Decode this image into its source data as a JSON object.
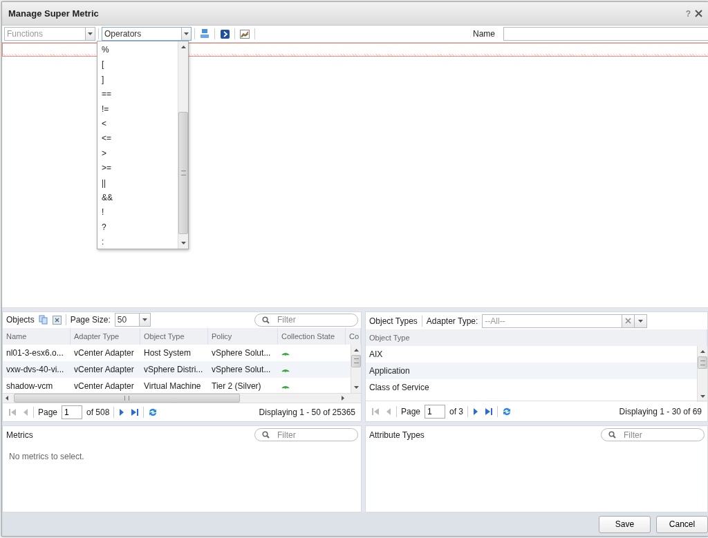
{
  "window": {
    "title": "Manage Super Metric",
    "help": "?"
  },
  "toolbar": {
    "functions": {
      "placeholder": "Functions"
    },
    "operators": {
      "value": "Operators",
      "expanded": true
    },
    "name_label": "Name"
  },
  "operators_menu": {
    "items": [
      "%",
      "[",
      "]",
      "==",
      "!=",
      "<",
      "<=",
      ">",
      ">=",
      "||",
      "&&",
      "!",
      "?",
      ":"
    ]
  },
  "editor": {
    "invalid": true
  },
  "objects": {
    "title": "Objects",
    "page_size_label": "Page Size:",
    "page_size": "50",
    "filter": {
      "placeholder": "Filter"
    },
    "columns": [
      "Name",
      "Adapter Type",
      "Object Type",
      "Policy",
      "Collection State",
      "Co"
    ],
    "rows": [
      {
        "cells": [
          "nl01-3-esx6.o...",
          "vCenter Adapter",
          "Host System",
          "vSphere Solut..."
        ],
        "collecting": true
      },
      {
        "cells": [
          "vxw-dvs-40-vi...",
          "vCenter Adapter",
          "vSphere Distri...",
          "vSphere Solut..."
        ],
        "collecting": true
      },
      {
        "cells": [
          "shadow-vcm",
          "vCenter Adapter",
          "Virtual Machine",
          "Tier 2 (Silver)"
        ],
        "collecting": true
      }
    ],
    "pager": {
      "page_label": "Page",
      "page": "1",
      "of": "of 508",
      "display": "Displaying 1 - 50 of 25365"
    }
  },
  "object_types": {
    "title": "Object Types",
    "adapter_label": "Adapter Type:",
    "adapter": {
      "placeholder": "--All--"
    },
    "column": "Object Type",
    "rows": [
      "AIX",
      "Application",
      "Class of Service"
    ],
    "pager": {
      "page_label": "Page",
      "page": "1",
      "of": "of 3",
      "display": "Displaying 1 - 30 of 69"
    }
  },
  "metrics": {
    "title": "Metrics",
    "filter": {
      "placeholder": "Filter"
    },
    "empty": "No metrics to select."
  },
  "attribute_types": {
    "title": "Attribute Types",
    "filter": {
      "placeholder": "Filter"
    }
  },
  "buttons": [
    "Save",
    "Cancel"
  ]
}
